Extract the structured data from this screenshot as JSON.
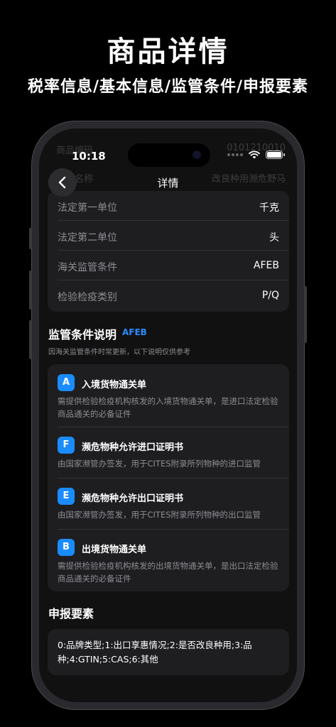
{
  "promo": {
    "title": "商品详情",
    "subtitle": "税率信息/基本信息/监管条件/申报要素"
  },
  "status_bar": {
    "time": "10:18"
  },
  "ghost_rows": [
    {
      "label": "商品编码",
      "value": "0101210010"
    },
    {
      "label": "商品名称",
      "value": "改良种用濒危野马"
    }
  ],
  "nav": {
    "title": "详情",
    "back_icon": "chevron-left-icon"
  },
  "info_rows": [
    {
      "label": "法定第一单位",
      "value": "千克"
    },
    {
      "label": "法定第二单位",
      "value": "头"
    },
    {
      "label": "海关监管条件",
      "value": "AFEB"
    },
    {
      "label": "检验检疫类别",
      "value": "P/Q"
    }
  ],
  "conditions": {
    "title": "监管条件说明",
    "code": "AFEB",
    "note": "因海关监管条件时常更新，以下说明仅供参考",
    "items": [
      {
        "badge": "A",
        "title": "入境货物通关单",
        "desc": "需提供检验检疫机构核发的入境货物通关单，是进口法定检验商品通关的必备证件"
      },
      {
        "badge": "F",
        "title": "濒危物种允许进口证明书",
        "desc": "由国家濒管办签发，用于CITES附录所列物种的进口监管"
      },
      {
        "badge": "E",
        "title": "濒危物种允许出口证明书",
        "desc": "由国家濒管办签发，用于CITES附录所列物种的出口监管"
      },
      {
        "badge": "B",
        "title": "出境货物通关单",
        "desc": "需提供检验检疫机构核发的出境货物通关单，是出口法定检验商品通关的必备证件"
      }
    ]
  },
  "declaration": {
    "title": "申报要素",
    "text": "0:品牌类型;1:出口享惠情况;2:是否改良种用;3:品种;4:GTIN;5:CAS;6:其他"
  },
  "colors": {
    "accent": "#1a8cff",
    "card": "#1e1e21",
    "muted": "#8e8e93"
  }
}
